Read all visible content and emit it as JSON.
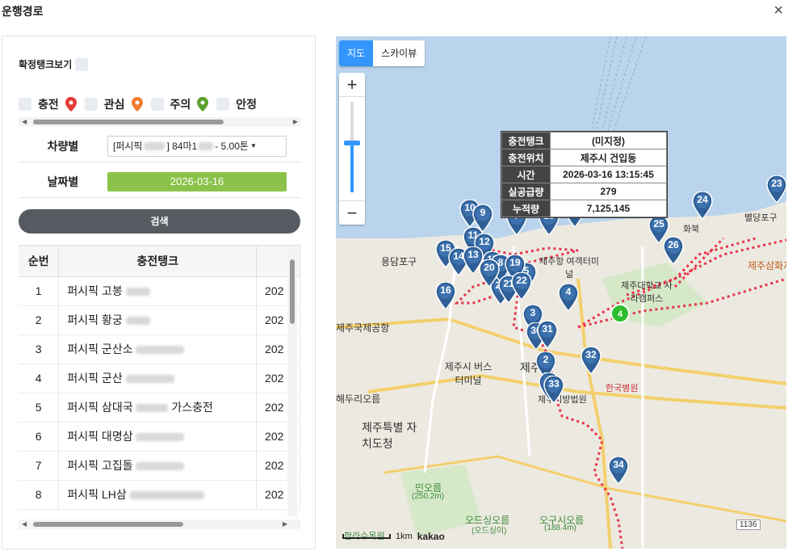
{
  "dialog": {
    "title": "운행경로",
    "close_label": "×"
  },
  "left": {
    "confirm_label": "확정탱크보기",
    "legend": [
      {
        "label": "충전",
        "pin_color": "#e53935"
      },
      {
        "label": "관심",
        "pin_color": "#ef7d2e"
      },
      {
        "label": "주의",
        "pin_color": "#5aa02c"
      },
      {
        "label": "안정",
        "pin_color": "#1e88e5"
      }
    ],
    "vehicle_label": "차량별",
    "vehicle_value_prefix": "[퍼시픽",
    "vehicle_value_mid": "] 84마1",
    "vehicle_value_suffix": "- 5.00톤",
    "date_label": "날짜별",
    "date_value": "2026-03-16",
    "search_label": "검색",
    "table": {
      "headers": [
        "순번",
        "충전탱크",
        ""
      ],
      "rows": [
        {
          "no": "1",
          "name": "퍼시픽 고봉",
          "extra": "",
          "date": "202"
        },
        {
          "no": "2",
          "name": "퍼시픽 황궁",
          "extra": "",
          "date": "202"
        },
        {
          "no": "3",
          "name": "퍼시픽 군산소",
          "extra": "",
          "date": "202"
        },
        {
          "no": "4",
          "name": "퍼시픽 군산",
          "extra": "",
          "date": "202"
        },
        {
          "no": "5",
          "name": "퍼시픽 삼대국",
          "extra": "가스충전",
          "date": "202"
        },
        {
          "no": "6",
          "name": "퍼시픽 대명삼",
          "extra": "",
          "date": "202"
        },
        {
          "no": "7",
          "name": "퍼시픽 고집돌",
          "extra": "",
          "date": "202"
        },
        {
          "no": "8",
          "name": "퍼시픽 LH삼",
          "extra": "",
          "date": "202"
        }
      ]
    }
  },
  "map": {
    "toggle": {
      "map_label": "지도",
      "sky_label": "스카이뷰"
    },
    "zoom_in": "+",
    "zoom_out": "−",
    "info": {
      "rows": [
        {
          "k": "충전탱크",
          "v": "(미지정)"
        },
        {
          "k": "충전위치",
          "v": "제주시 건입동"
        },
        {
          "k": "시간",
          "v": "2026-03-16 13:15:45"
        },
        {
          "k": "실공급량",
          "v": "279"
        },
        {
          "k": "누적량",
          "v": "7,125,145"
        }
      ]
    },
    "scale_label": "1km",
    "brand": "kakao",
    "labels": {
      "yongdampo": "용담포구",
      "airport": "제주국제공항",
      "bus_terminal": "제주시 버스터미널",
      "jeju_si": "제주시",
      "doli": "해두리오름",
      "dochung": "제주특별 자치도청",
      "minoreum": "민오름",
      "minoreum_h": "(250.2m)",
      "odeusi": "오드싱오름",
      "odeusi_sub": "(오드싱이)",
      "oguni": "오구시오름",
      "oguni_h": "(188.4m)",
      "hallasu": "한라수목원",
      "univ": "제주대학교 사라캠퍼스",
      "samhwa": "제주삼화지",
      "byeol": "별당포구",
      "hwabuk": "화북",
      "court": "제주지방법원",
      "hospital": "한국병원",
      "terminal": "제주항 여객터미널",
      "road": "1136"
    },
    "markers": [
      "10",
      "9",
      "7",
      "28",
      "27",
      "11",
      "12",
      "15",
      "14",
      "13",
      "17",
      "18",
      "6",
      "5",
      "29",
      "16",
      "4",
      "3",
      "30",
      "31",
      "2",
      "32",
      "25",
      "26",
      "24",
      "23",
      "34",
      "1",
      "8",
      "19",
      "20",
      "21",
      "22",
      "33"
    ],
    "current_marker": "4"
  }
}
